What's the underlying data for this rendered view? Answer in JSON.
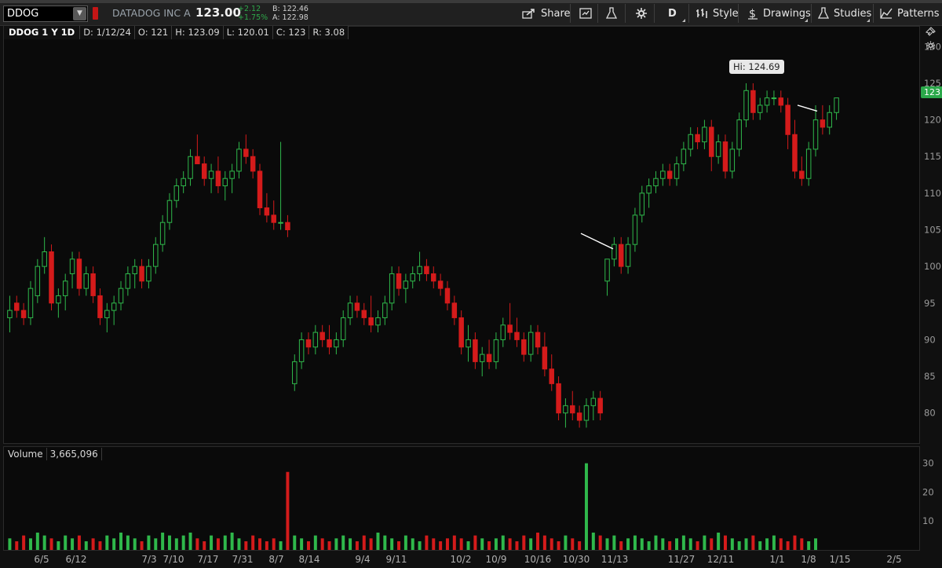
{
  "toolbar": {
    "symbol": "DDOG",
    "company": "DATADOG INC A",
    "last": "123.00",
    "change": "+2.12",
    "change_pct": "+1.75%",
    "bid": "B: 122.46",
    "ask": "A: 122.98",
    "share_label": "Share",
    "period_label": "D",
    "style_label": "Style",
    "drawings_label": "Drawings",
    "studies_label": "Studies",
    "patterns_label": "Patterns"
  },
  "info_bar": {
    "timeframe": "DDOG 1 Y 1D",
    "date": "D: 1/12/24",
    "open": "O: 121",
    "high": "H: 123.09",
    "low": "L: 120.01",
    "close": "C: 123",
    "range": "R: 3.08"
  },
  "hi_marker": "Hi: 124.69",
  "price_tag": "123",
  "volume_panel": {
    "label": "Volume",
    "value": "3,665,096"
  },
  "colors": {
    "up": "#2fb84b",
    "down": "#d41b1b",
    "accent": "#2ba84a"
  },
  "chart_data": {
    "type": "candlestick",
    "symbol": "DDOG",
    "timeframe": "1D",
    "y_ticks": [
      80,
      85,
      90,
      95,
      100,
      105,
      110,
      115,
      120,
      125,
      130
    ],
    "ylim": [
      76,
      131
    ],
    "volume_ticks": [
      10,
      20,
      30
    ],
    "x_ticks": [
      "6/5",
      "6/12",
      "7/3",
      "7/10",
      "7/17",
      "7/31",
      "8/7",
      "8/14",
      "9/4",
      "9/11",
      "10/2",
      "10/9",
      "10/16",
      "10/30",
      "11/13",
      "11/27",
      "12/11",
      "1/1",
      "1/8",
      "1/15",
      "2/5"
    ],
    "ohlc": [
      [
        93,
        96,
        91,
        94
      ],
      [
        95,
        96,
        93,
        94
      ],
      [
        94,
        95,
        92,
        93
      ],
      [
        93,
        98,
        92,
        97
      ],
      [
        96,
        101,
        95,
        100
      ],
      [
        100,
        104,
        99,
        102
      ],
      [
        102,
        103,
        94,
        95
      ],
      [
        95,
        97,
        93,
        96
      ],
      [
        96,
        99,
        94,
        98
      ],
      [
        99,
        102,
        97,
        101
      ],
      [
        101,
        102,
        96,
        97
      ],
      [
        97,
        100,
        96,
        99
      ],
      [
        99,
        100,
        95,
        96
      ],
      [
        96,
        97,
        92,
        93
      ],
      [
        93,
        95,
        91,
        94
      ],
      [
        94,
        96,
        92,
        95
      ],
      [
        95,
        98,
        94,
        97
      ],
      [
        97,
        100,
        96,
        99
      ],
      [
        99,
        101,
        97,
        100
      ],
      [
        100,
        101,
        97,
        98
      ],
      [
        98,
        101,
        97,
        100
      ],
      [
        100,
        104,
        99,
        103
      ],
      [
        103,
        107,
        102,
        106
      ],
      [
        106,
        110,
        105,
        109
      ],
      [
        109,
        112,
        108,
        111
      ],
      [
        111,
        113,
        110,
        112
      ],
      [
        112,
        116,
        111,
        115
      ],
      [
        115,
        118,
        114,
        114
      ],
      [
        114,
        115,
        111,
        112
      ],
      [
        112,
        114,
        110,
        113
      ],
      [
        113,
        115,
        110,
        111
      ],
      [
        111,
        113,
        109,
        112
      ],
      [
        112,
        114,
        110,
        113
      ],
      [
        113,
        117,
        112,
        116
      ],
      [
        116,
        118,
        114,
        115
      ],
      [
        115,
        116,
        112,
        113
      ],
      [
        113,
        114,
        107,
        108
      ],
      [
        108,
        110,
        106,
        107
      ],
      [
        107,
        109,
        105,
        106
      ],
      [
        106,
        117,
        105,
        106
      ],
      [
        106,
        107,
        104,
        105
      ],
      [
        84,
        88,
        83,
        87
      ],
      [
        87,
        91,
        86,
        90
      ],
      [
        90,
        91,
        88,
        89
      ],
      [
        89,
        92,
        88,
        91
      ],
      [
        91,
        92,
        89,
        90
      ],
      [
        90,
        92,
        88,
        89
      ],
      [
        89,
        91,
        88,
        90
      ],
      [
        90,
        94,
        89,
        93
      ],
      [
        93,
        96,
        92,
        95
      ],
      [
        95,
        96,
        93,
        94
      ],
      [
        94,
        95,
        92,
        93
      ],
      [
        93,
        96,
        91,
        92
      ],
      [
        92,
        94,
        91,
        93
      ],
      [
        93,
        96,
        92,
        95
      ],
      [
        95,
        100,
        94,
        99
      ],
      [
        99,
        100,
        96,
        97
      ],
      [
        97,
        99,
        95,
        98
      ],
      [
        98,
        100,
        97,
        99
      ],
      [
        99,
        102,
        98,
        100
      ],
      [
        100,
        101,
        98,
        99
      ],
      [
        99,
        100,
        97,
        98
      ],
      [
        98,
        99,
        96,
        97
      ],
      [
        97,
        98,
        94,
        95
      ],
      [
        95,
        96,
        92,
        93
      ],
      [
        93,
        94,
        88,
        89
      ],
      [
        89,
        92,
        87,
        90
      ],
      [
        90,
        91,
        86,
        87
      ],
      [
        87,
        89,
        85,
        88
      ],
      [
        88,
        90,
        86,
        87
      ],
      [
        87,
        91,
        86,
        90
      ],
      [
        90,
        93,
        89,
        92
      ],
      [
        92,
        95,
        90,
        91
      ],
      [
        91,
        93,
        89,
        90
      ],
      [
        90,
        91,
        87,
        88
      ],
      [
        88,
        92,
        87,
        91
      ],
      [
        91,
        92,
        88,
        89
      ],
      [
        89,
        91,
        85,
        86
      ],
      [
        86,
        88,
        83,
        84
      ],
      [
        84,
        85,
        79,
        80
      ],
      [
        80,
        82,
        78,
        81
      ],
      [
        81,
        83,
        79,
        80
      ],
      [
        80,
        81,
        78,
        79
      ],
      [
        79,
        82,
        78,
        81
      ],
      [
        81,
        83,
        79,
        82
      ],
      [
        82,
        83,
        79,
        80
      ],
      [
        98,
        100,
        96,
        101
      ],
      [
        101,
        104,
        100,
        103
      ],
      [
        103,
        104,
        99,
        100
      ],
      [
        100,
        104,
        99,
        103
      ],
      [
        103,
        108,
        102,
        107
      ],
      [
        107,
        111,
        106,
        110
      ],
      [
        110,
        112,
        108,
        111
      ],
      [
        111,
        113,
        110,
        112
      ],
      [
        112,
        114,
        111,
        113
      ],
      [
        113,
        114,
        111,
        112
      ],
      [
        112,
        115,
        111,
        114
      ],
      [
        114,
        117,
        113,
        116
      ],
      [
        116,
        119,
        115,
        118
      ],
      [
        118,
        119,
        116,
        117
      ],
      [
        117,
        120,
        116,
        119
      ],
      [
        119,
        120,
        113,
        115
      ],
      [
        115,
        118,
        114,
        117
      ],
      [
        117,
        118,
        112,
        113
      ],
      [
        113,
        117,
        112,
        116
      ],
      [
        116,
        121,
        115,
        120
      ],
      [
        120,
        125,
        119,
        124
      ],
      [
        124,
        125,
        120,
        121
      ],
      [
        121,
        123,
        120,
        122
      ],
      [
        122,
        124,
        121,
        123
      ],
      [
        123,
        124,
        122,
        123
      ],
      [
        123,
        124,
        121,
        122
      ],
      [
        122,
        123,
        116,
        118
      ],
      [
        118,
        120,
        112,
        113
      ],
      [
        113,
        115,
        111,
        112
      ],
      [
        112,
        117,
        111,
        116
      ],
      [
        116,
        122,
        115,
        120
      ],
      [
        120,
        122,
        118,
        119
      ],
      [
        119,
        122,
        118,
        121
      ],
      [
        121,
        123,
        120,
        123
      ]
    ],
    "volume": [
      4,
      3,
      5,
      4,
      6,
      5,
      4,
      3,
      5,
      4,
      5,
      3,
      4,
      3,
      5,
      4,
      6,
      5,
      4,
      3,
      5,
      4,
      6,
      5,
      4,
      5,
      6,
      4,
      3,
      5,
      4,
      5,
      6,
      4,
      3,
      5,
      4,
      3,
      4,
      3,
      27,
      5,
      4,
      3,
      5,
      4,
      3,
      4,
      5,
      4,
      3,
      5,
      4,
      6,
      5,
      4,
      3,
      5,
      4,
      3,
      5,
      4,
      3,
      4,
      5,
      4,
      3,
      5,
      4,
      3,
      4,
      5,
      4,
      3,
      5,
      4,
      6,
      5,
      4,
      3,
      5,
      4,
      3,
      30,
      6,
      5,
      4,
      5,
      3,
      4,
      5,
      4,
      3,
      5,
      4,
      3,
      4,
      5,
      4,
      3,
      5,
      4,
      6,
      5,
      4,
      3,
      4,
      5,
      3,
      4,
      5,
      4,
      3,
      5,
      4,
      3,
      4
    ]
  }
}
